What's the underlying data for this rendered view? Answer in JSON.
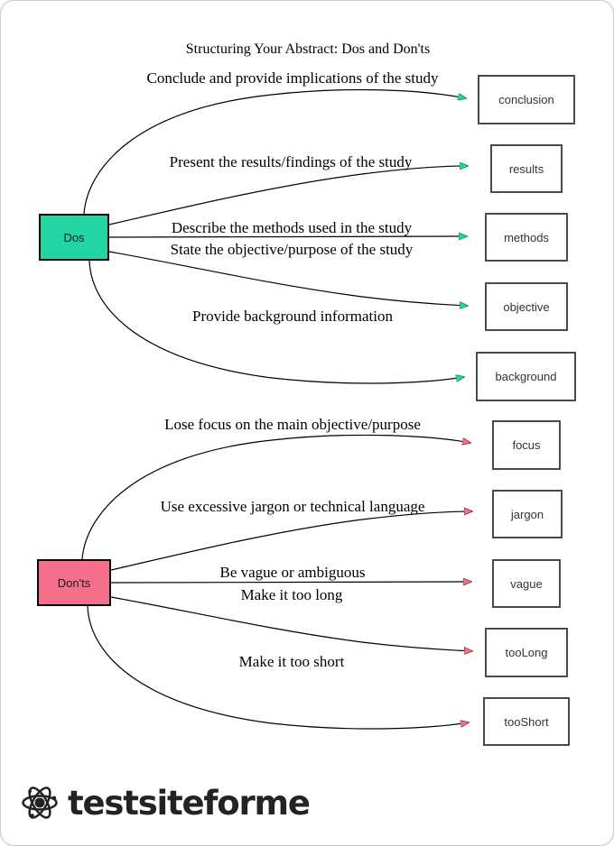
{
  "page": {
    "title": "Structuring Your Abstract: Dos and Don'ts"
  },
  "diagram": {
    "type": "mindmap-flowchart",
    "roots": [
      {
        "id": "dos",
        "label": "Dos",
        "color": "#21D6A0",
        "arrow_color": "#21D6A0"
      },
      {
        "id": "donts",
        "label": "Don'ts",
        "color": "#F4708A",
        "arrow_color": "#F4708A"
      }
    ],
    "branches": [
      {
        "root": "dos",
        "edges": [
          {
            "label": "Conclude and provide implications of the study",
            "target": "conclusion"
          },
          {
            "label": "Present the results/findings of the study",
            "target": "results"
          },
          {
            "label": "Describe the methods used in the study",
            "target": "methods"
          },
          {
            "label": "State the objective/purpose of the study",
            "target": "objective"
          },
          {
            "label": "Provide background information",
            "target": "background"
          }
        ]
      },
      {
        "root": "donts",
        "edges": [
          {
            "label": "Lose focus on the main objective/purpose",
            "target": "focus"
          },
          {
            "label": "Use excessive jargon or technical language",
            "target": "jargon"
          },
          {
            "label": "Be vague or ambiguous",
            "target": "vague"
          },
          {
            "label": "Make it too long",
            "target": "tooLong"
          },
          {
            "label": "Make it too short",
            "target": "tooShort"
          }
        ]
      }
    ],
    "leaf_nodes": [
      {
        "id": "conclusion",
        "label": "conclusion"
      },
      {
        "id": "results",
        "label": "results"
      },
      {
        "id": "methods",
        "label": "methods"
      },
      {
        "id": "objective",
        "label": "objective"
      },
      {
        "id": "background",
        "label": "background"
      },
      {
        "id": "focus",
        "label": "focus"
      },
      {
        "id": "jargon",
        "label": "jargon"
      },
      {
        "id": "vague",
        "label": "vague"
      },
      {
        "id": "tooLong",
        "label": "tooLong"
      },
      {
        "id": "tooShort",
        "label": "tooShort"
      }
    ]
  },
  "footer": {
    "brand": "testsiteforme",
    "logo_icon": "atom-icon"
  }
}
